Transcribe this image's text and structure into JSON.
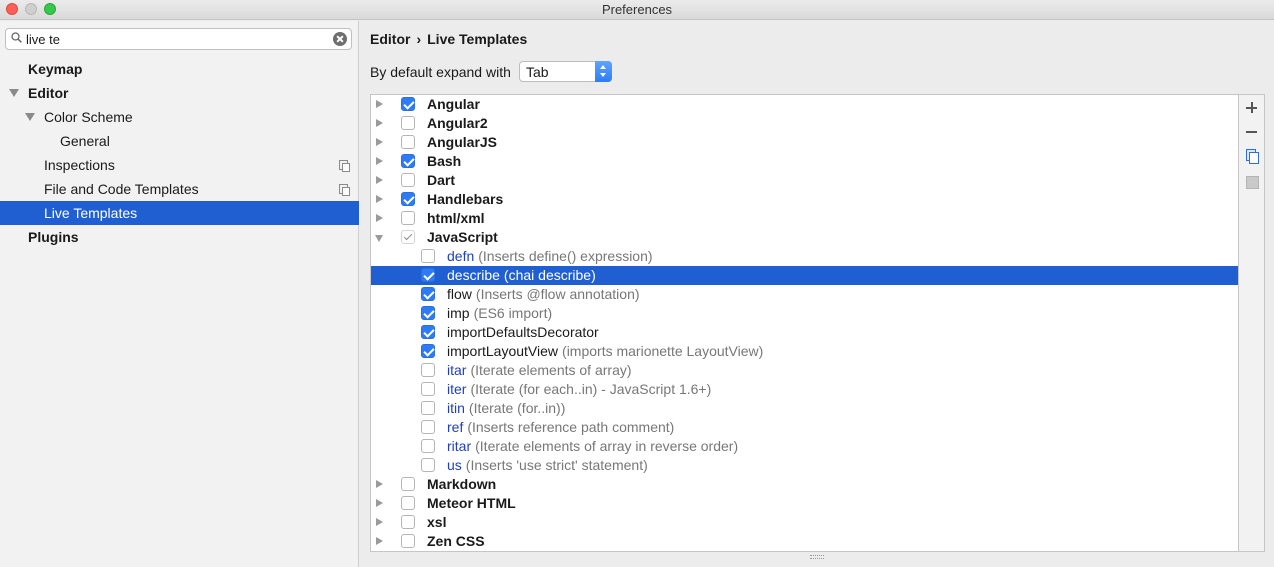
{
  "window": {
    "title": "Preferences"
  },
  "search": {
    "value": "live te"
  },
  "sidebar": {
    "items": [
      {
        "label": "Keymap"
      },
      {
        "label": "Editor"
      },
      {
        "label": "Color Scheme"
      },
      {
        "label": "General"
      },
      {
        "label": "Inspections"
      },
      {
        "label": "File and Code Templates"
      },
      {
        "label": "Live Templates"
      },
      {
        "label": "Plugins"
      }
    ]
  },
  "content": {
    "breadcrumb": {
      "parent": "Editor",
      "separator": "›",
      "current": "Live Templates"
    },
    "expand": {
      "label": "By default expand with",
      "value": "Tab"
    },
    "groups": [
      {
        "name": "Angular",
        "checked": true
      },
      {
        "name": "Angular2",
        "checked": false
      },
      {
        "name": "AngularJS",
        "checked": false
      },
      {
        "name": "Bash",
        "checked": true
      },
      {
        "name": "Dart",
        "checked": false
      },
      {
        "name": "Handlebars",
        "checked": true
      },
      {
        "name": "html/xml",
        "checked": false
      },
      {
        "name": "JavaScript",
        "checked": "partial"
      }
    ],
    "js_templates": [
      {
        "abbr": "defn",
        "desc": "(Inserts define() expression)",
        "checked": false
      },
      {
        "abbr": "describe",
        "desc": "(chai describe)",
        "checked": true
      },
      {
        "abbr": "flow",
        "desc": "(Inserts @flow annotation)",
        "checked": true
      },
      {
        "abbr": "imp",
        "desc": "(ES6 import)",
        "checked": true
      },
      {
        "abbr": "importDefaultsDecorator",
        "desc": "",
        "checked": true
      },
      {
        "abbr": "importLayoutView",
        "desc": "(imports marionette LayoutView)",
        "checked": true
      },
      {
        "abbr": "itar",
        "desc": "(Iterate elements of array)",
        "checked": false
      },
      {
        "abbr": "iter",
        "desc": "(Iterate (for each..in) - JavaScript 1.6+)",
        "checked": false
      },
      {
        "abbr": "itin",
        "desc": "(Iterate (for..in))",
        "checked": false
      },
      {
        "abbr": "ref",
        "desc": "(Inserts reference path comment)",
        "checked": false
      },
      {
        "abbr": "ritar",
        "desc": "(Iterate elements of array in reverse order)",
        "checked": false
      },
      {
        "abbr": "us",
        "desc": "(Inserts 'use strict' statement)",
        "checked": false
      }
    ],
    "groups_after": [
      {
        "name": "Markdown",
        "checked": false
      },
      {
        "name": "Meteor HTML",
        "checked": false
      },
      {
        "name": "xsl",
        "checked": false
      },
      {
        "name": "Zen CSS",
        "checked": false
      }
    ]
  },
  "colors": {
    "selection": "#1f5fd1",
    "checkbox_on": "#2f7bf5",
    "abbr_disabled": "#1f3fbf"
  }
}
